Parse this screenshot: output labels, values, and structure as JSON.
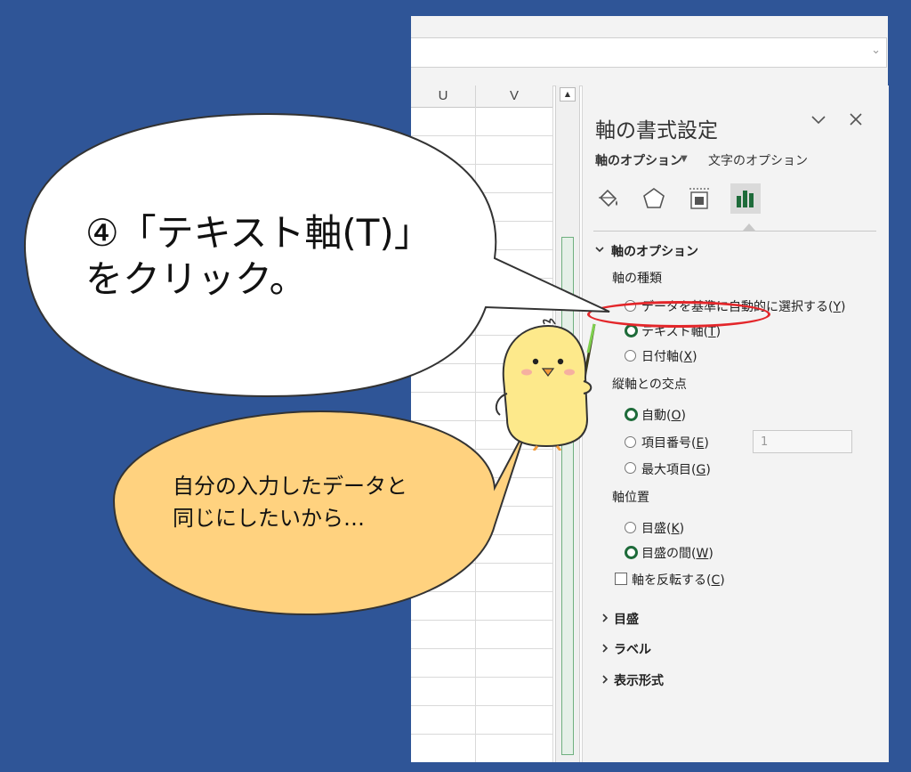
{
  "callout": {
    "line1": "④「テキスト軸(T)」",
    "line2": "をクリック。",
    "hint_line1": "自分の入力したデータと",
    "hint_line2": "同じにしたいから…"
  },
  "spreadsheet": {
    "columns": [
      "U",
      "V"
    ],
    "scroll_up_icon": "▲",
    "formula_dropdown_icon": "chevron-down"
  },
  "pane": {
    "title": "軸の書式設定",
    "collapse_icon": "chevron-down",
    "close_icon": "close",
    "tabs": {
      "axis_options": "軸のオプション",
      "text_options": "文字のオプション"
    },
    "icons": [
      "fill-line-icon",
      "effects-icon",
      "size-properties-icon",
      "axis-options-icon"
    ],
    "section_title": "軸のオプション",
    "axis_type": {
      "label": "軸の種類",
      "options": [
        {
          "label": "データを基準に自動的に選択する(",
          "key": "Y",
          "selected": false
        },
        {
          "label": "テキスト軸(",
          "key": "T",
          "selected": true
        },
        {
          "label": "日付軸(",
          "key": "X",
          "selected": false
        }
      ]
    },
    "crosses": {
      "label": "縦軸との交点",
      "options": [
        {
          "label": "自動(",
          "key": "O",
          "selected": true
        },
        {
          "label": "項目番号(",
          "key": "E",
          "selected": false
        },
        {
          "label": "最大項目(",
          "key": "G",
          "selected": false
        }
      ],
      "number_value": "1"
    },
    "axis_position": {
      "label": "軸位置",
      "options": [
        {
          "label": "目盛(",
          "key": "K",
          "selected": false
        },
        {
          "label": "目盛の間(",
          "key": "W",
          "selected": true
        }
      ]
    },
    "reverse": {
      "label": "軸を反転する(",
      "key": "C",
      "checked": false
    },
    "collapsed_sections": [
      "目盛",
      "ラベル",
      "表示形式"
    ]
  },
  "colors": {
    "background": "#2f5597",
    "highlight": "#e3262a",
    "radio_selected": "#1e6b3a",
    "hint_bubble": "#ffd27f"
  }
}
